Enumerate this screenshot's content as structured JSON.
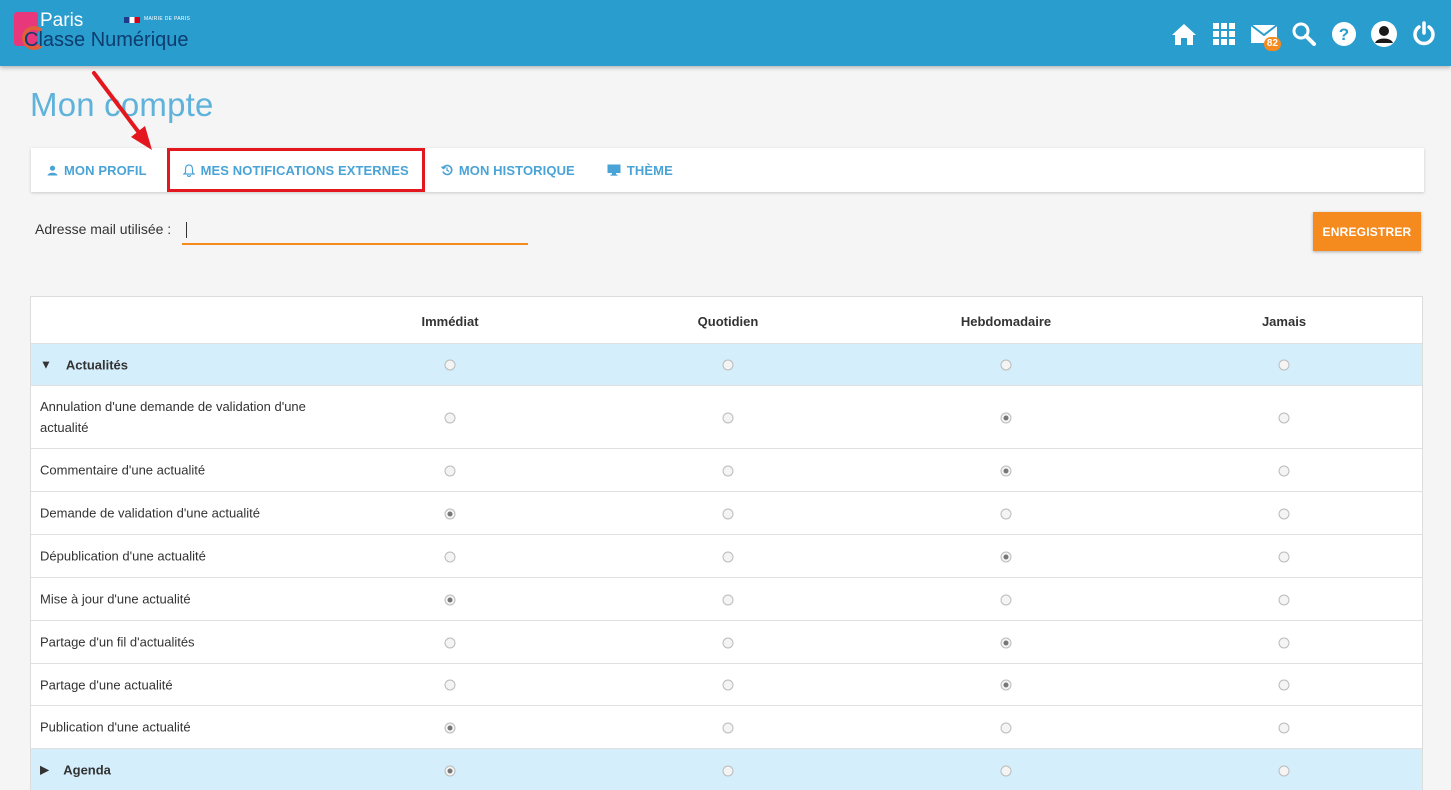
{
  "header": {
    "logo_paris": "Paris",
    "logo_name": "Classe Numérique",
    "logo_mairie": "MAIRIE DE PARIS",
    "mail_badge": "82",
    "icons": [
      "home-icon",
      "apps-grid-icon",
      "mail-icon",
      "search-icon",
      "help-icon",
      "user-icon",
      "power-icon"
    ]
  },
  "page_title": "Mon compte",
  "tabs": [
    {
      "label": "MON PROFIL",
      "icon": "user-icon"
    },
    {
      "label": "MES NOTIFICATIONS EXTERNES",
      "icon": "bell-icon",
      "active": true
    },
    {
      "label": "MON HISTORIQUE",
      "icon": "history-icon"
    },
    {
      "label": "THÈME",
      "icon": "monitor-icon"
    }
  ],
  "email": {
    "label": "Adresse mail utilisée :",
    "value": ""
  },
  "save_label": "ENREGISTRER",
  "table": {
    "columns": [
      "Immédiat",
      "Quotidien",
      "Hebdomadaire",
      "Jamais"
    ],
    "rows": [
      {
        "label": "Actualités",
        "section": true,
        "expanded": true,
        "toggle": "▼",
        "selected": null
      },
      {
        "label": "Annulation d'une demande de validation d'une actualité",
        "selected": 2
      },
      {
        "label": "Commentaire d'une actualité",
        "selected": 2
      },
      {
        "label": "Demande de validation d'une actualité",
        "selected": 0
      },
      {
        "label": "Dépublication d'une actualité",
        "selected": 2
      },
      {
        "label": "Mise à jour d'une actualité",
        "selected": 0
      },
      {
        "label": "Partage d'un fil d'actualités",
        "selected": 2
      },
      {
        "label": "Partage d'une actualité",
        "selected": 2
      },
      {
        "label": "Publication d'une actualité",
        "selected": 0
      },
      {
        "label": "Agenda",
        "section": true,
        "expanded": false,
        "toggle": "▶",
        "selected": 0
      }
    ]
  },
  "colors": {
    "topbar": "#2a9dcf",
    "accent": "#f58a1f",
    "tab_text": "#4aa3d6",
    "section_bg": "#d4eefb",
    "highlight": "#e3171d"
  }
}
